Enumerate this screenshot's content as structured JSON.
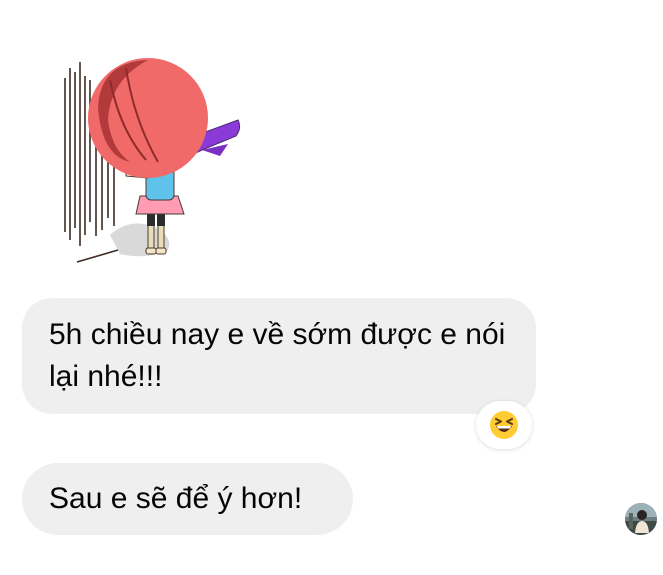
{
  "messages": [
    {
      "type": "sticker",
      "icon": "sticker-girl-facing-wall-icon"
    },
    {
      "type": "text",
      "text": "5h chiều nay e về sớm được e nói lại nhé!!!",
      "reaction": {
        "icon": "grinning-squinting-face-icon"
      }
    },
    {
      "type": "text",
      "text": "Sau e sẽ để ý hơn!"
    }
  ],
  "read_receipt": {
    "icon": "avatar-icon"
  },
  "colors": {
    "bubble_bg": "#efefef",
    "text": "#050505",
    "background": "#ffffff"
  }
}
